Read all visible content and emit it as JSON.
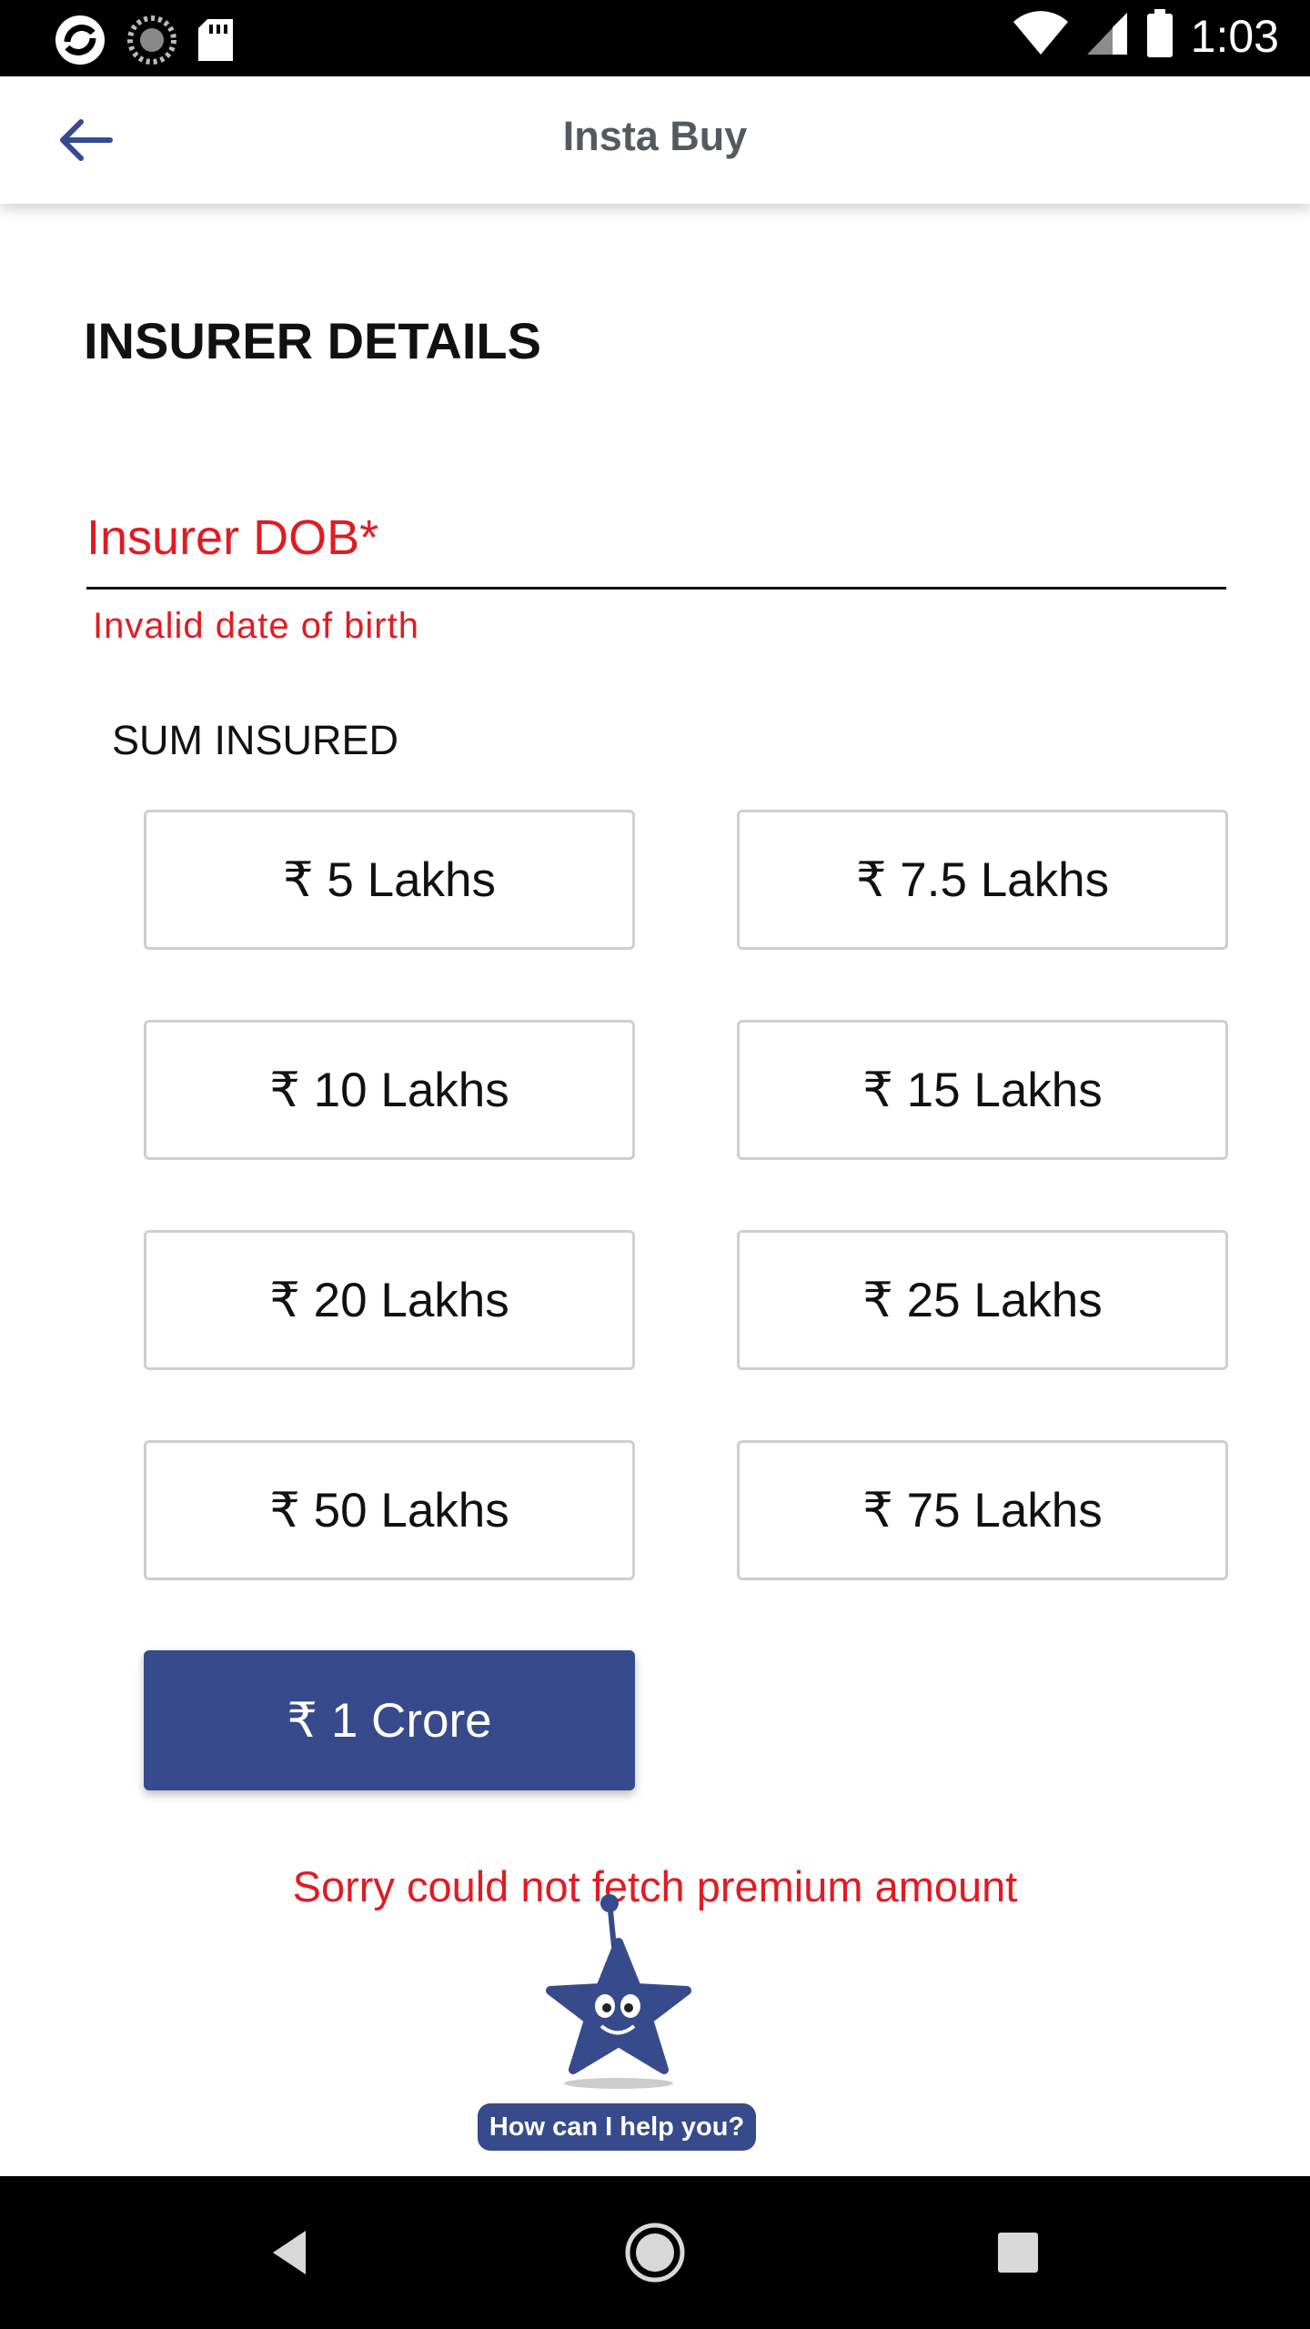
{
  "status_bar": {
    "time": "1:03",
    "icons": [
      "app-notification-icon",
      "sync-icon",
      "sd-card-icon",
      "wifi-icon",
      "signal-icon",
      "battery-icon"
    ]
  },
  "app_bar": {
    "title": "Insta Buy",
    "back_icon": "back-arrow-icon",
    "accent_color": "#374a8b"
  },
  "section": {
    "title": "INSURER DETAILS"
  },
  "dob_field": {
    "label": "Insurer DOB*",
    "value": "",
    "error": "Invalid date of birth",
    "error_color": "#e11b22"
  },
  "sum_insured": {
    "label": "SUM INSURED",
    "options": [
      {
        "label": "₹ 5 Lakhs",
        "selected": false
      },
      {
        "label": "₹ 7.5 Lakhs",
        "selected": false
      },
      {
        "label": "₹ 10 Lakhs",
        "selected": false
      },
      {
        "label": "₹ 15 Lakhs",
        "selected": false
      },
      {
        "label": "₹ 20 Lakhs",
        "selected": false
      },
      {
        "label": "₹ 25 Lakhs",
        "selected": false
      },
      {
        "label": "₹ 50 Lakhs",
        "selected": false
      },
      {
        "label": "₹ 75 Lakhs",
        "selected": false
      },
      {
        "label": "₹ 1 Crore",
        "selected": true
      }
    ],
    "selected_color": "#374a8b"
  },
  "premium_error": "Sorry could not fetch premium amount",
  "chat_helper": {
    "label": "How can I help you?",
    "icon": "star-mascot-icon"
  },
  "nav_bar": {
    "icons": [
      "nav-back-icon",
      "nav-home-icon",
      "nav-recents-icon"
    ]
  }
}
